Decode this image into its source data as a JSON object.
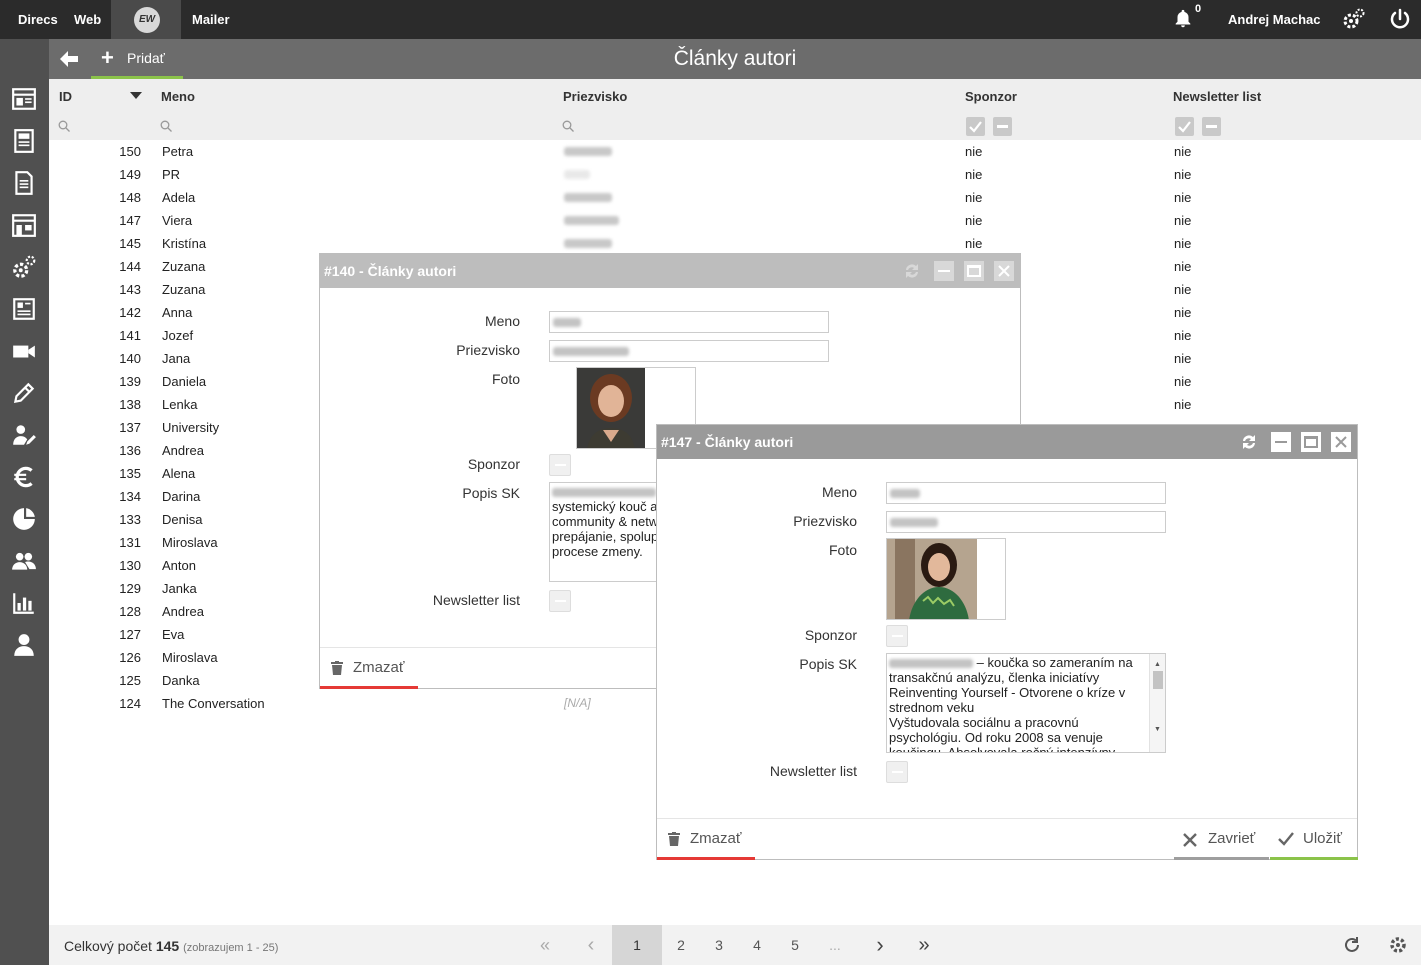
{
  "topbar": {
    "nav": [
      "Direcs",
      "Web",
      "Mailer"
    ],
    "logo": "EW",
    "notification_count": "0",
    "user_name": "Andrej Machac",
    "icons": [
      "bell-icon",
      "settings-gears-icon",
      "power-icon"
    ]
  },
  "sidebar": {
    "icons": [
      "layout-icon",
      "page-icon",
      "document-icon",
      "store-icon",
      "gears-icon",
      "news-icon",
      "video-icon",
      "pencil-icon",
      "user-edit-icon",
      "euro-icon",
      "pie-chart-icon",
      "users-icon",
      "bar-chart-icon",
      "user-icon"
    ]
  },
  "subbar": {
    "add_label": "Pridať",
    "title": "Články autori"
  },
  "table": {
    "columns": {
      "id": "ID",
      "name": "Meno",
      "surname": "Priezvisko",
      "sponsor": "Sponzor",
      "newsletter": "Newsletter list"
    },
    "rows": [
      {
        "id": "150",
        "name": "Petra",
        "sponsor": "nie",
        "newsletter": "nie"
      },
      {
        "id": "149",
        "name": "PR",
        "sponsor": "nie",
        "newsletter": "nie"
      },
      {
        "id": "148",
        "name": "Adela",
        "sponsor": "nie",
        "newsletter": "nie"
      },
      {
        "id": "147",
        "name": "Viera",
        "sponsor": "nie",
        "newsletter": "nie"
      },
      {
        "id": "145",
        "name": "Kristína",
        "sponsor": "nie",
        "newsletter": "nie"
      },
      {
        "id": "144",
        "name": "Zuzana",
        "sponsor": "",
        "newsletter": "nie"
      },
      {
        "id": "143",
        "name": "Zuzana",
        "sponsor": "",
        "newsletter": "nie"
      },
      {
        "id": "142",
        "name": "Anna",
        "sponsor": "",
        "newsletter": "nie"
      },
      {
        "id": "141",
        "name": "Jozef",
        "sponsor": "",
        "newsletter": "nie"
      },
      {
        "id": "140",
        "name": "Jana",
        "sponsor": "",
        "newsletter": "nie"
      },
      {
        "id": "139",
        "name": "Daniela",
        "sponsor": "",
        "newsletter": "nie"
      },
      {
        "id": "138",
        "name": "Lenka",
        "sponsor": "",
        "newsletter": "nie"
      },
      {
        "id": "137",
        "name": "University",
        "sponsor": "",
        "newsletter": ""
      },
      {
        "id": "136",
        "name": "Andrea",
        "sponsor": "",
        "newsletter": ""
      },
      {
        "id": "135",
        "name": "Alena",
        "sponsor": "",
        "newsletter": ""
      },
      {
        "id": "134",
        "name": "Darina",
        "sponsor": "",
        "newsletter": ""
      },
      {
        "id": "133",
        "name": "Denisa",
        "sponsor": "",
        "newsletter": ""
      },
      {
        "id": "131",
        "name": "Miroslava",
        "sponsor": "",
        "newsletter": ""
      },
      {
        "id": "130",
        "name": "Anton",
        "sponsor": "",
        "newsletter": ""
      },
      {
        "id": "129",
        "name": "Janka",
        "sponsor": "",
        "newsletter": ""
      },
      {
        "id": "128",
        "name": "Andrea",
        "sponsor": "",
        "newsletter": ""
      },
      {
        "id": "127",
        "name": "Eva",
        "sponsor": "",
        "newsletter": ""
      },
      {
        "id": "126",
        "name": "Miroslava",
        "sponsor": "",
        "newsletter": ""
      },
      {
        "id": "125",
        "name": "Danka",
        "sponsor": "",
        "newsletter": ""
      },
      {
        "id": "124",
        "name": "The Conversation",
        "sponsor": "",
        "newsletter": ""
      }
    ],
    "na_text": "[N/A]"
  },
  "footer": {
    "total_label": "Celkový počet",
    "total_count": "145",
    "showing": "(zobrazujem 1 - 25)",
    "pages": [
      "1",
      "2",
      "3",
      "4",
      "5",
      "..."
    ],
    "current_page": "1"
  },
  "dialog_140": {
    "title": "#140 - Články autori",
    "labels": {
      "name": "Meno",
      "surname": "Priezvisko",
      "photo": "Foto",
      "sponsor": "Sponzor",
      "description": "Popis SK",
      "newsletter": "Newsletter list"
    },
    "description_lines": [
      "systemický kouč a",
      "community & netw",
      "prepájanie, spolup",
      "procese zmeny."
    ],
    "delete_label": "Zmazať"
  },
  "dialog_147": {
    "title": "#147 - Články autori",
    "labels": {
      "name": "Meno",
      "surname": "Priezvisko",
      "photo": "Foto",
      "sponsor": "Sponzor",
      "description": "Popis SK",
      "newsletter": "Newsletter list"
    },
    "description_first": "– koučka so zameraním na",
    "description_lines": [
      "transakčnú analýzu, členka iniciatívy",
      "Reinventing Yourself - Otvorene o kríze v",
      "strednom veku",
      "Vyštudovala sociálnu a pracovnú",
      "psychológiu. Od roku 2008 sa venuje",
      "koučingu. Absolvovala ročný intenzívny"
    ],
    "delete_label": "Zmazať",
    "close_label": "Zavrieť",
    "save_label": "Uložiť"
  },
  "colors": {
    "topbar": "#2b2b2b",
    "sidebar": "#505050",
    "subbar": "#6c6c6c",
    "accent_green": "#8bc34a",
    "accent_red": "#e53935"
  }
}
